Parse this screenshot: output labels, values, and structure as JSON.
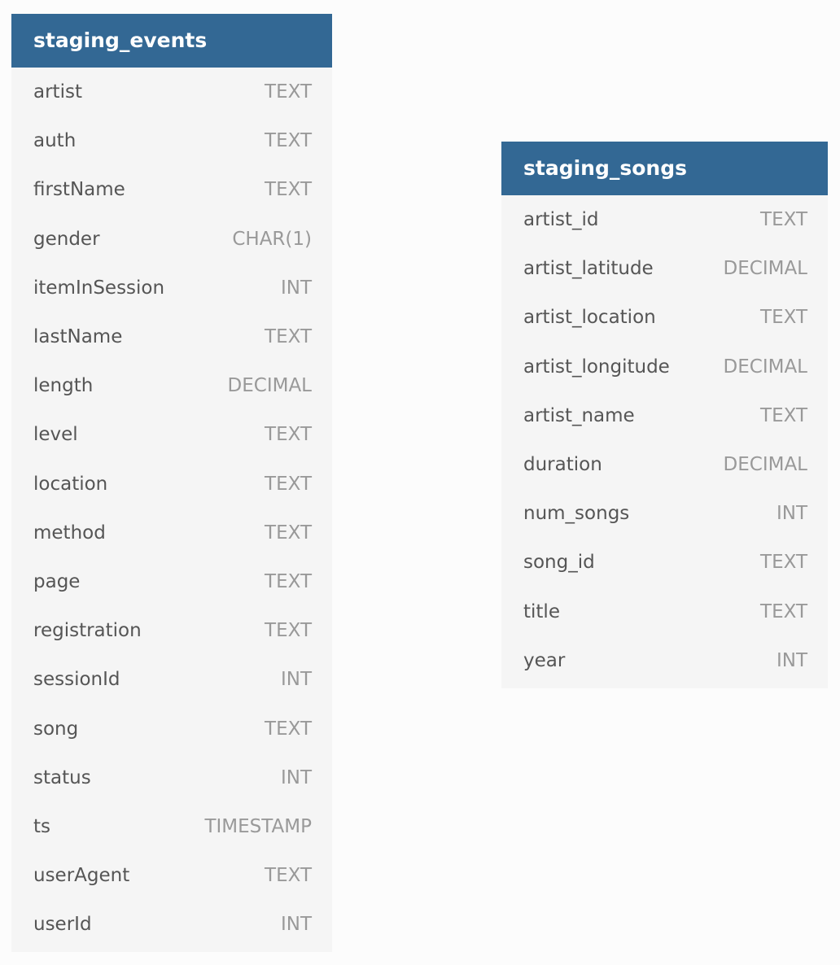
{
  "tables": [
    {
      "name": "staging_events",
      "columns": [
        {
          "name": "artist",
          "type": "TEXT"
        },
        {
          "name": "auth",
          "type": "TEXT"
        },
        {
          "name": "firstName",
          "type": "TEXT"
        },
        {
          "name": "gender",
          "type": "CHAR(1)"
        },
        {
          "name": "itemInSession",
          "type": "INT"
        },
        {
          "name": "lastName",
          "type": "TEXT"
        },
        {
          "name": "length",
          "type": "DECIMAL"
        },
        {
          "name": "level",
          "type": "TEXT"
        },
        {
          "name": "location",
          "type": "TEXT"
        },
        {
          "name": "method",
          "type": "TEXT"
        },
        {
          "name": "page",
          "type": "TEXT"
        },
        {
          "name": "registration",
          "type": "TEXT"
        },
        {
          "name": "sessionId",
          "type": "INT"
        },
        {
          "name": "song",
          "type": "TEXT"
        },
        {
          "name": "status",
          "type": "INT"
        },
        {
          "name": "ts",
          "type": "TIMESTAMP"
        },
        {
          "name": "userAgent",
          "type": "TEXT"
        },
        {
          "name": "userId",
          "type": "INT"
        }
      ]
    },
    {
      "name": "staging_songs",
      "columns": [
        {
          "name": "artist_id",
          "type": "TEXT"
        },
        {
          "name": "artist_latitude",
          "type": "DECIMAL"
        },
        {
          "name": "artist_location",
          "type": "TEXT"
        },
        {
          "name": "artist_longitude",
          "type": "DECIMAL"
        },
        {
          "name": "artist_name",
          "type": "TEXT"
        },
        {
          "name": "duration",
          "type": "DECIMAL"
        },
        {
          "name": "num_songs",
          "type": "INT"
        },
        {
          "name": "song_id",
          "type": "TEXT"
        },
        {
          "name": "title",
          "type": "TEXT"
        },
        {
          "name": "year",
          "type": "INT"
        }
      ]
    }
  ],
  "colors": {
    "header_bg": "#336894",
    "header_text": "#ffffff",
    "table_bg": "#f5f5f5",
    "column_name": "#555555",
    "column_type": "#999999",
    "canvas_bg": "#fcfcfc"
  }
}
